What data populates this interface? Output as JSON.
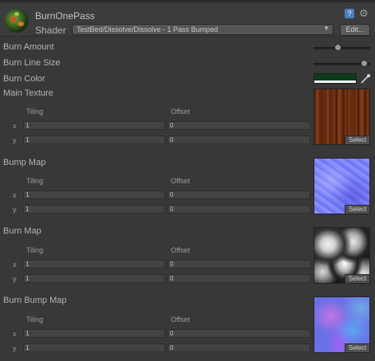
{
  "material": {
    "name": "BurnOnePass",
    "shader_label": "Shader",
    "shader_value": "TestBed/Dissolve/Dissolve - 1 Pass Bumped",
    "edit_label": "Edit..."
  },
  "properties": {
    "burn_amount": {
      "label": "Burn Amount",
      "value": 0.42
    },
    "burn_line_size": {
      "label": "Burn Line Size",
      "value": 0.95
    },
    "burn_color": {
      "label": "Burn Color",
      "color": "#0d3b1c"
    },
    "main_texture": {
      "label": "Main Texture",
      "tiling_label": "Tiling",
      "offset_label": "Offset",
      "x_label": "x",
      "y_label": "y",
      "tiling_x": "1",
      "tiling_y": "1",
      "offset_x": "0",
      "offset_y": "0",
      "select_label": "Select"
    },
    "bump_map": {
      "label": "Bump Map",
      "tiling_label": "Tiling",
      "offset_label": "Offset",
      "x_label": "x",
      "y_label": "y",
      "tiling_x": "1",
      "tiling_y": "1",
      "offset_x": "0",
      "offset_y": "0",
      "select_label": "Select"
    },
    "burn_map": {
      "label": "Burn Map",
      "tiling_label": "Tiling",
      "offset_label": "Offset",
      "x_label": "x",
      "y_label": "y",
      "tiling_x": "1",
      "tiling_y": "1",
      "offset_x": "0",
      "offset_y": "0",
      "select_label": "Select"
    },
    "burn_bump_map": {
      "label": "Burn Bump Map",
      "tiling_label": "Tiling",
      "offset_label": "Offset",
      "x_label": "x",
      "y_label": "y",
      "tiling_x": "1",
      "tiling_y": "1",
      "offset_x": "0",
      "offset_y": "0",
      "select_label": "Select"
    }
  },
  "icons": {
    "material": "material-sphere-icon",
    "help": "help-book-icon",
    "settings": "gear-icon",
    "eyedropper": "eyedropper-icon",
    "dropdown": "chevron-down-icon"
  }
}
